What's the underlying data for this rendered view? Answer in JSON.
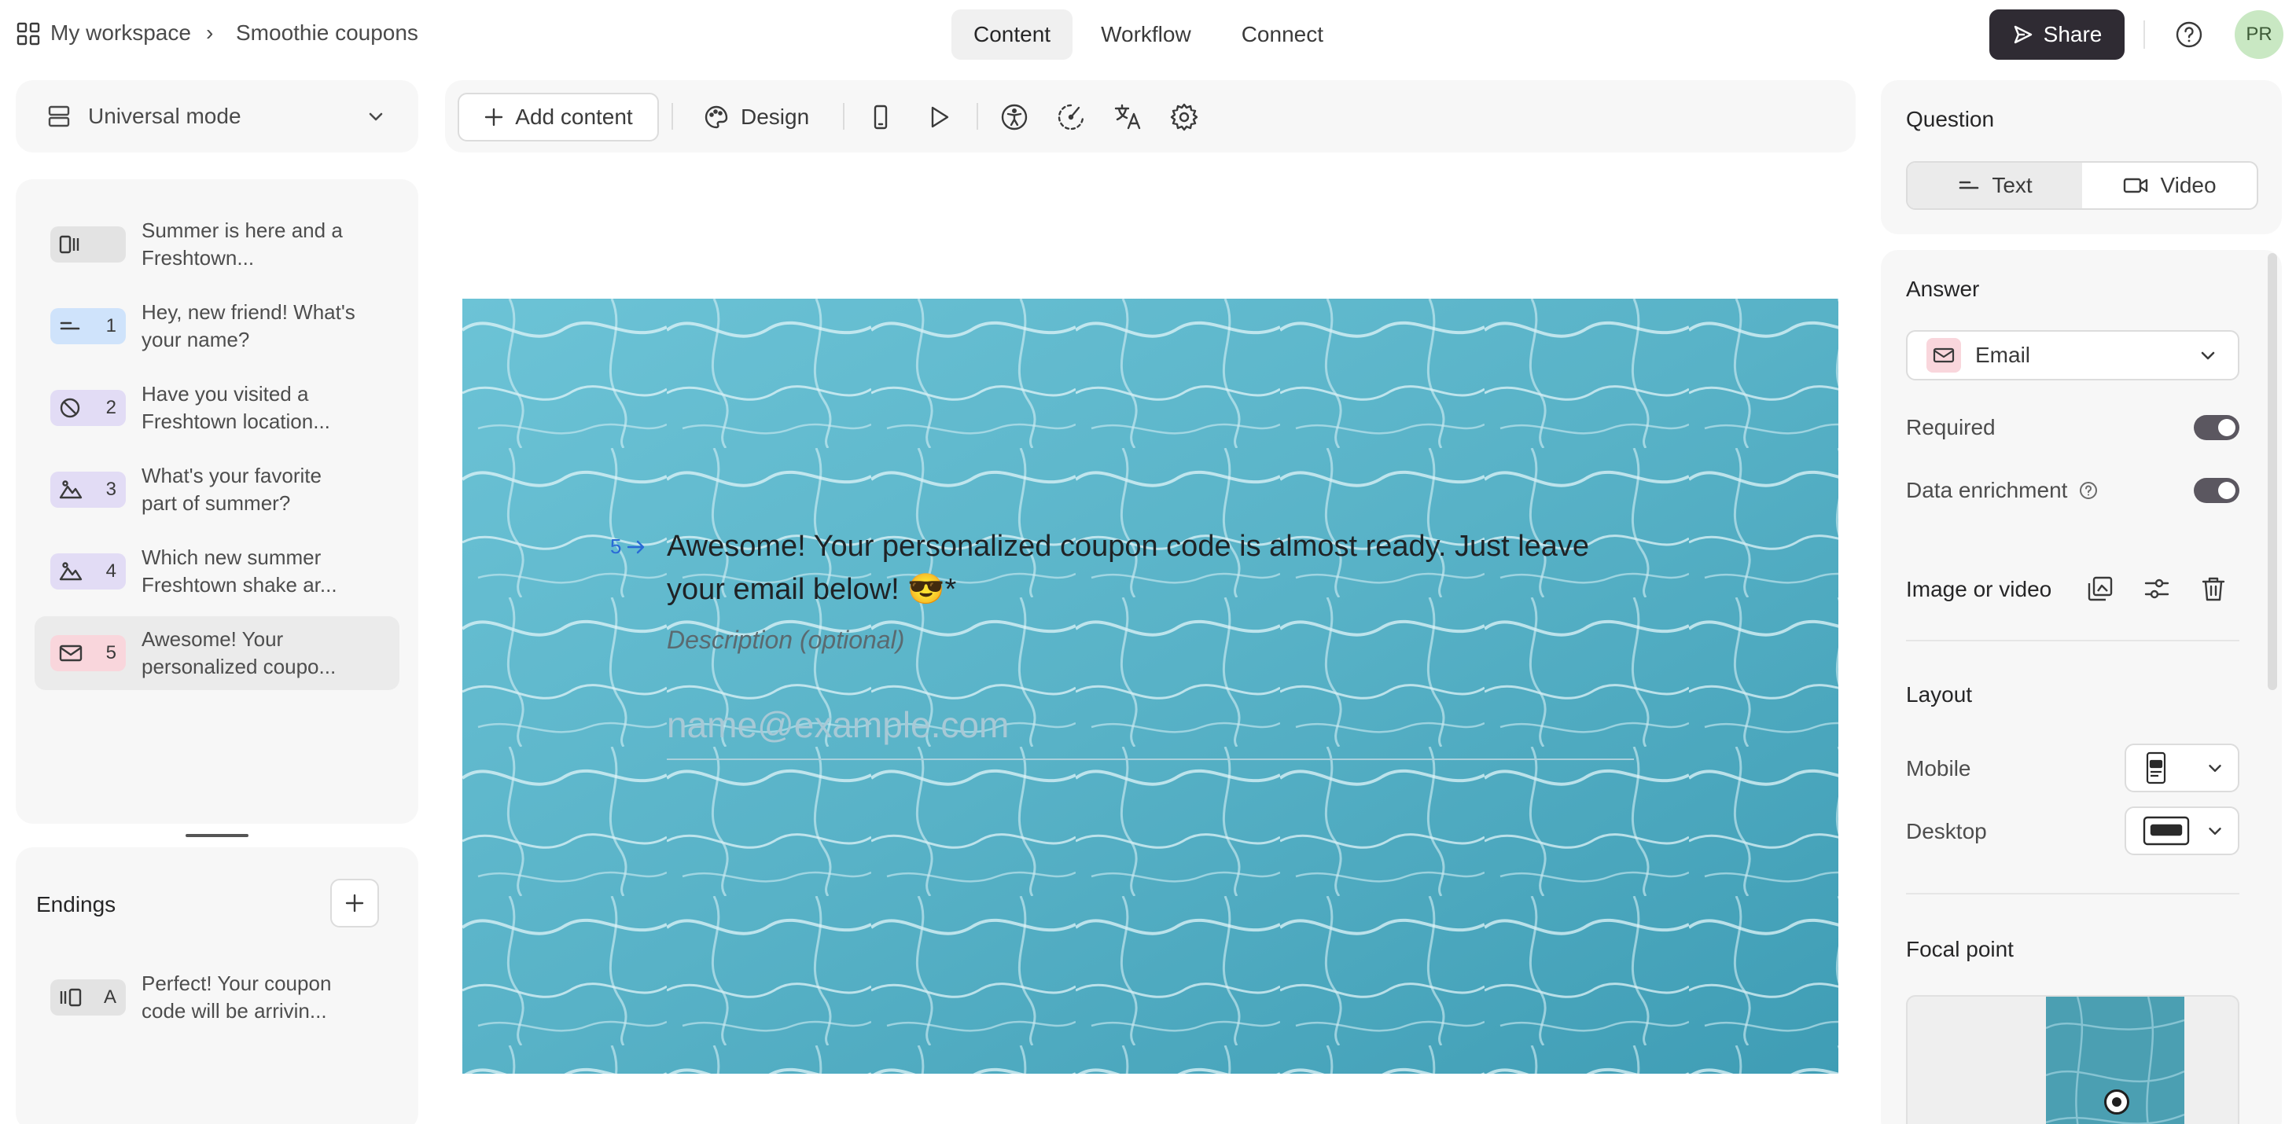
{
  "breadcrumb": {
    "workspace": "My workspace",
    "separator": "›",
    "form": "Smoothie coupons"
  },
  "tabs": [
    {
      "label": "Content",
      "active": true
    },
    {
      "label": "Workflow",
      "active": false
    },
    {
      "label": "Connect",
      "active": false
    }
  ],
  "header": {
    "share_label": "Share",
    "avatar_initials": "PR"
  },
  "mode": {
    "label": "Universal mode"
  },
  "questions": [
    {
      "number": "",
      "text": "Summer is here and a Freshtown...",
      "badge_color": "#e3e3e3",
      "icon": "welcome-screen-icon"
    },
    {
      "number": "1",
      "text": "Hey, new friend! What's your name?",
      "badge_color": "#cfe3fb",
      "icon": "short-text-icon"
    },
    {
      "number": "2",
      "text": "Have you visited a Freshtown location...",
      "badge_color": "#e2dcf5",
      "icon": "yes-no-icon"
    },
    {
      "number": "3",
      "text": "What's your favorite part of summer?",
      "badge_color": "#e2dcf5",
      "icon": "picture-choice-icon"
    },
    {
      "number": "4",
      "text": "Which new summer Freshtown shake ar...",
      "badge_color": "#e2dcf5",
      "icon": "picture-choice-icon"
    },
    {
      "number": "5",
      "text": "Awesome! Your personalized coupo...",
      "badge_color": "#f9d6dc",
      "icon": "email-icon",
      "active": true
    }
  ],
  "endings": {
    "title": "Endings",
    "items": [
      {
        "letter": "A",
        "text": "Perfect! Your coupon code will be arrivin..."
      }
    ]
  },
  "toolbar": {
    "add_content_label": "Add content",
    "design_label": "Design"
  },
  "canvas": {
    "question_number": "5",
    "question_title": "Awesome! Your personalized coupon code is almost ready. Just leave your email below! 😎*",
    "description_placeholder": "Description (optional)",
    "input_placeholder": "name@example.com"
  },
  "right_panel": {
    "question_title": "Question",
    "question_types": [
      "Text",
      "Video"
    ],
    "answer_title": "Answer",
    "answer_type": "Email",
    "required_label": "Required",
    "required_on": true,
    "data_enrichment_label": "Data enrichment",
    "data_enrichment_on": true,
    "image_video_label": "Image or video",
    "layout_title": "Layout",
    "mobile_label": "Mobile",
    "desktop_label": "Desktop",
    "focal_point_title": "Focal point"
  },
  "colors": {
    "accent_dark": "#2f2b33",
    "email_badge": "#f9d6dc",
    "link_blue": "#2a6bd6"
  }
}
